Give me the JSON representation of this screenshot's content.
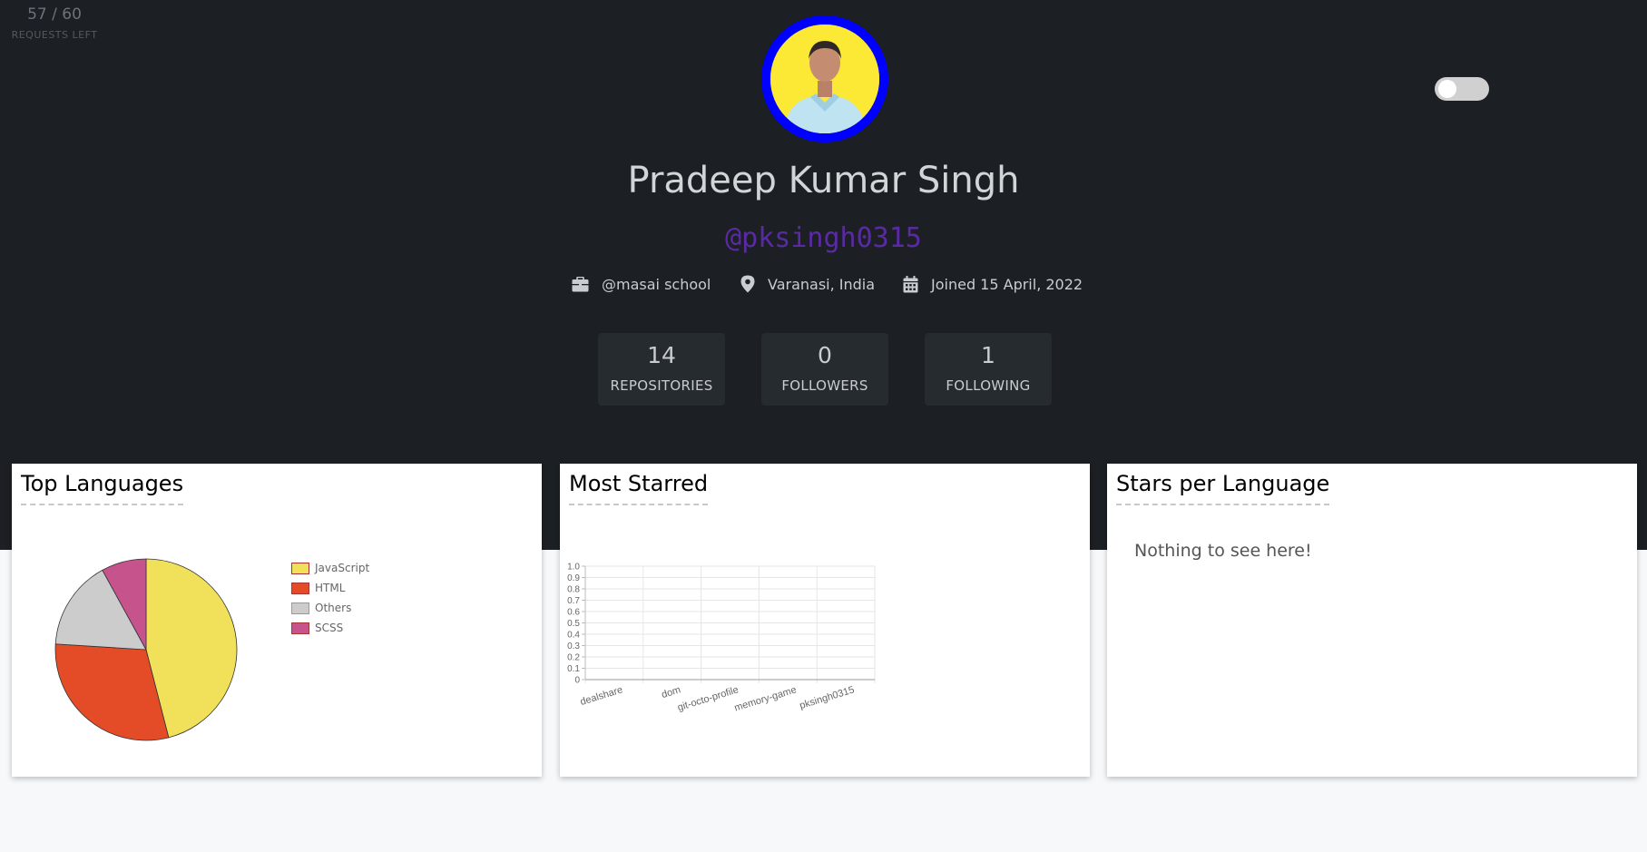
{
  "rate_limit": {
    "count": "57 / 60",
    "label": "REQUESTS LEFT"
  },
  "profile": {
    "name": "Pradeep Kumar Singh",
    "login": "@pksingh0315",
    "company": "@masai school",
    "location": "Varanasi, India",
    "joined": "Joined 15 April, 2022"
  },
  "stats": [
    {
      "value": "14",
      "label": "REPOSITORIES"
    },
    {
      "value": "0",
      "label": "FOLLOWERS"
    },
    {
      "value": "1",
      "label": "FOLLOWING"
    }
  ],
  "cards": {
    "top_languages": {
      "title": "Top Languages"
    },
    "most_starred": {
      "title": "Most Starred"
    },
    "stars_per_language": {
      "title": "Stars per Language",
      "empty_text": "Nothing to see here!"
    }
  },
  "chart_data": [
    {
      "type": "pie",
      "title": "Top Languages",
      "labels": [
        "JavaScript",
        "HTML",
        "Others",
        "SCSS"
      ],
      "values": [
        46,
        30,
        16,
        8
      ],
      "colors": [
        "#f1e05a",
        "#e34c26",
        "#cccccc",
        "#c6538c"
      ]
    },
    {
      "type": "bar",
      "title": "Most Starred",
      "categories": [
        "dealshare",
        "dom",
        "git-octo-profile",
        "memory-game",
        "pksingh0315"
      ],
      "values": [
        0,
        0,
        0,
        0,
        0
      ],
      "ylim": [
        0,
        1.0
      ],
      "yticks": [
        "0",
        "0.1",
        "0.2",
        "0.3",
        "0.4",
        "0.5",
        "0.6",
        "0.7",
        "0.8",
        "0.9",
        "1.0"
      ],
      "grid": true
    }
  ],
  "icons": {
    "company": "briefcase-icon",
    "location": "map-pin-icon",
    "joined": "calendar-icon"
  },
  "colors": {
    "header_bg": "#1c1f23",
    "avatar_ring": "#0000ff",
    "login": "#5a2aa4",
    "stat_bg": "#262b30"
  }
}
